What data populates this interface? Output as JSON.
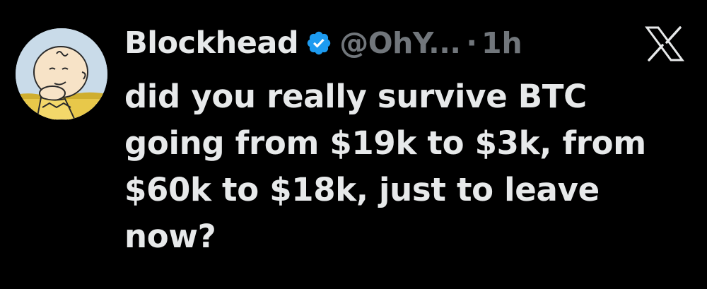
{
  "tweet": {
    "author": {
      "display_name": "Blockhead",
      "handle": "@OhY...",
      "verified_icon": "verified-badge-icon",
      "avatar_icon": "avatar"
    },
    "separator": "·",
    "timestamp": "1h",
    "platform_icon": "x-logo-icon",
    "text_lines": [
      "did you really survive BTC",
      "going from $19k to $3k, from",
      "$60k to $18k, just to leave",
      "now?"
    ]
  },
  "colors": {
    "background": "#000000",
    "primary_text": "#e7e9ea",
    "secondary_text": "#71767b",
    "verified_blue": "#1d9bf0"
  }
}
